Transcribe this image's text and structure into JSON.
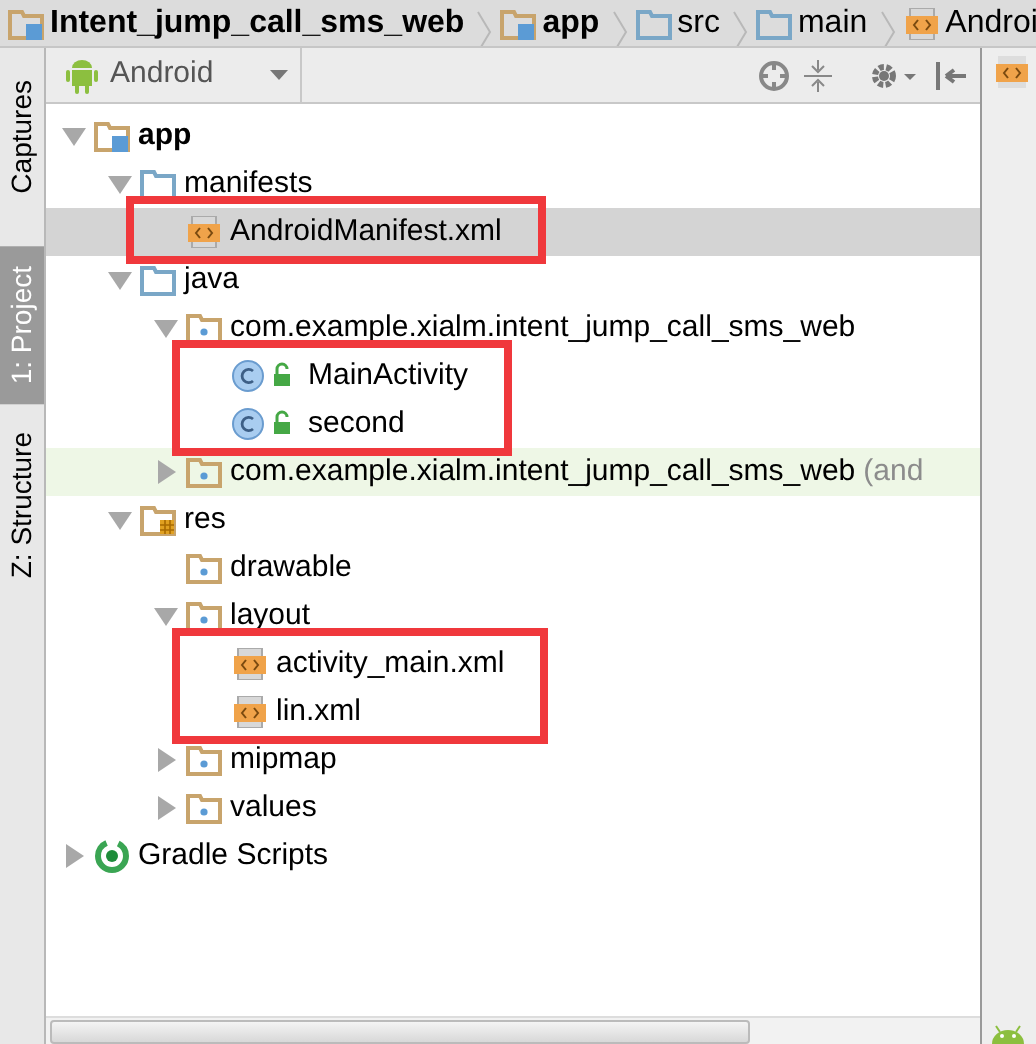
{
  "breadcrumbs": [
    {
      "label": "Intent_jump_call_sms_web",
      "kind": "module"
    },
    {
      "label": "app",
      "kind": "module"
    },
    {
      "label": "src",
      "kind": "folder"
    },
    {
      "label": "main",
      "kind": "folder"
    },
    {
      "label": "Androi",
      "kind": "file"
    }
  ],
  "side_tabs": [
    {
      "label": "Captures",
      "selected": false
    },
    {
      "label": "1: Project",
      "selected": true
    },
    {
      "label": "Z: Structure",
      "selected": false
    }
  ],
  "view_selector": "Android",
  "tree": [
    {
      "label": "app",
      "kind": "module",
      "expanded": true,
      "children": [
        {
          "label": "manifests",
          "kind": "folder",
          "expanded": true,
          "children": [
            {
              "label": "AndroidManifest.xml",
              "kind": "xml",
              "selected": true,
              "boxed": true
            }
          ]
        },
        {
          "label": "java",
          "kind": "folder",
          "expanded": true,
          "children": [
            {
              "label": "com.example.xialm.intent_jump_call_sms_web",
              "kind": "package",
              "expanded": true,
              "children": [
                {
                  "label": "MainActivity",
                  "kind": "class",
                  "boxed": true
                },
                {
                  "label": "second",
                  "kind": "class",
                  "boxed": true
                }
              ]
            },
            {
              "label": "com.example.xialm.intent_jump_call_sms_web",
              "note": "(and",
              "kind": "package",
              "expanded": false,
              "tinted": true
            }
          ]
        },
        {
          "label": "res",
          "kind": "res",
          "expanded": true,
          "children": [
            {
              "label": "drawable",
              "kind": "package"
            },
            {
              "label": "layout",
              "kind": "package",
              "expanded": true,
              "children": [
                {
                  "label": "activity_main.xml",
                  "kind": "xml",
                  "boxed": true
                },
                {
                  "label": "lin.xml",
                  "kind": "xml",
                  "boxed": true
                }
              ]
            },
            {
              "label": "mipmap",
              "kind": "package",
              "expanded": false
            },
            {
              "label": "values",
              "kind": "package",
              "expanded": false
            }
          ]
        }
      ]
    },
    {
      "label": "Gradle Scripts",
      "kind": "gradle",
      "expanded": false
    }
  ]
}
